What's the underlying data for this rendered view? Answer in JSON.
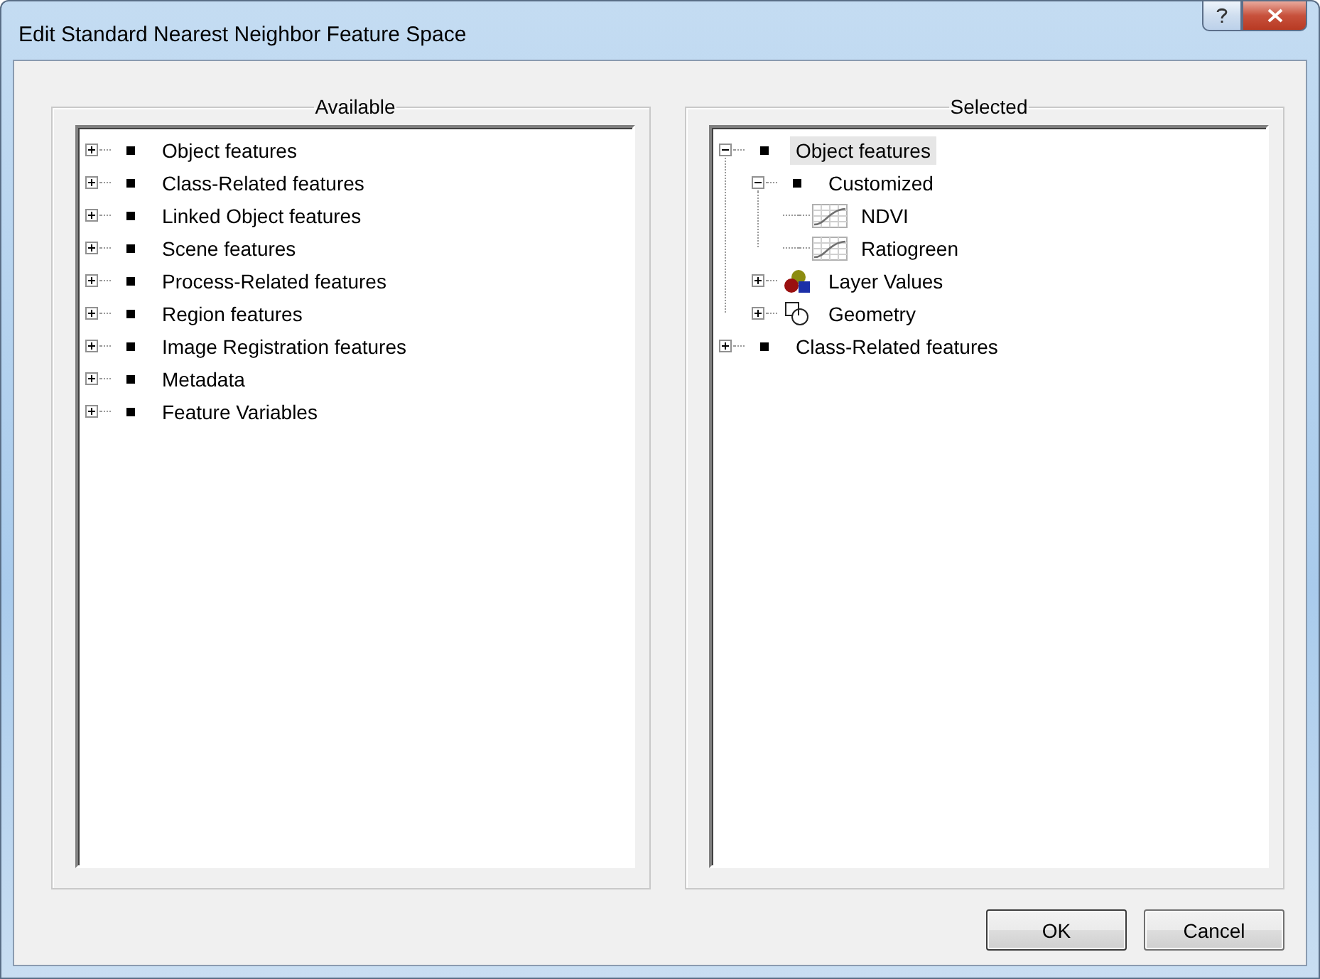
{
  "window": {
    "title": "Edit Standard Nearest Neighbor Feature Space"
  },
  "panels": [
    {
      "title": "Available",
      "tree": [
        {
          "label": "Object features",
          "kind": "feature",
          "expanded": false,
          "selected": false
        },
        {
          "label": "Class-Related features",
          "kind": "feature",
          "expanded": false,
          "selected": false
        },
        {
          "label": "Linked Object features",
          "kind": "feature",
          "expanded": false,
          "selected": false
        },
        {
          "label": "Scene features",
          "kind": "feature",
          "expanded": false,
          "selected": false
        },
        {
          "label": "Process-Related features",
          "kind": "feature",
          "expanded": false,
          "selected": false
        },
        {
          "label": "Region features",
          "kind": "feature",
          "expanded": false,
          "selected": false
        },
        {
          "label": "Image Registration features",
          "kind": "feature",
          "expanded": false,
          "selected": false
        },
        {
          "label": "Metadata",
          "kind": "feature",
          "expanded": false,
          "selected": false
        },
        {
          "label": "Feature Variables",
          "kind": "feature",
          "expanded": false,
          "selected": false
        }
      ]
    },
    {
      "title": "Selected",
      "tree": [
        {
          "label": "Object features",
          "kind": "feature",
          "expanded": true,
          "selected": true,
          "children": [
            {
              "label": "Customized",
              "kind": "feature",
              "expanded": true,
              "selected": false,
              "children": [
                {
                  "label": "NDVI",
                  "kind": "custom",
                  "selected": false
                },
                {
                  "label": "Ratiogreen",
                  "kind": "custom",
                  "selected": false
                }
              ]
            },
            {
              "label": "Layer Values",
              "kind": "layers",
              "expanded": false,
              "selected": false
            },
            {
              "label": "Geometry",
              "kind": "geometry",
              "expanded": false,
              "selected": false
            }
          ]
        },
        {
          "label": "Class-Related features",
          "kind": "feature",
          "expanded": false,
          "selected": false
        }
      ]
    }
  ],
  "buttons": [
    {
      "label": "OK",
      "default": true
    },
    {
      "label": "Cancel",
      "default": false
    }
  ]
}
